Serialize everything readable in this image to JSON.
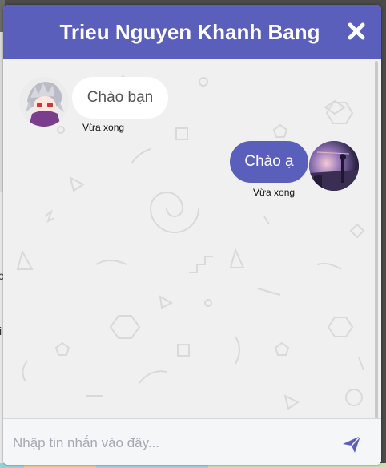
{
  "chat": {
    "title": "Trieu Nguyen Khanh Bang",
    "messages": [
      {
        "direction": "incoming",
        "text": "Chào bạn",
        "time": "Vừa xong"
      },
      {
        "direction": "outgoing",
        "text": "Chào ạ",
        "time": "Vừa xong"
      }
    ],
    "composer": {
      "placeholder": "Nhập tin nhắn vào đây..."
    }
  },
  "background_page": {
    "fragments": [
      "c",
      "i"
    ]
  },
  "colors": {
    "accent": "#5b5fbc",
    "chat_background": "#f0f0f0",
    "incoming_bubble": "#ffffff",
    "outgoing_bubble": "#5b5fbc"
  },
  "icons": {
    "close": "close-icon",
    "send": "send-icon"
  }
}
